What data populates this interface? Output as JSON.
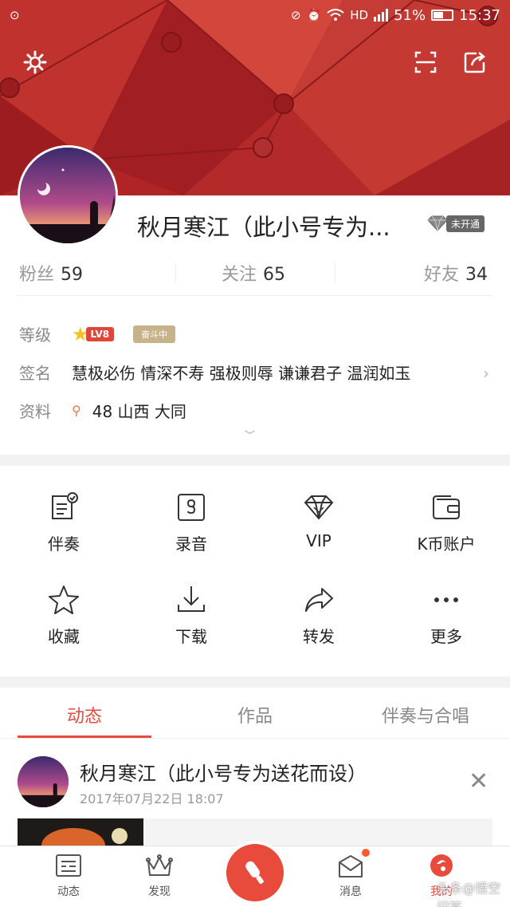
{
  "status": {
    "battery": "51%",
    "time": "15:37",
    "network": "HD"
  },
  "profile": {
    "name": "秋月寒江（此小号专为...",
    "vip_tag": "未开通",
    "stats": {
      "fans_label": "粉丝",
      "fans": "59",
      "follow_label": "关注",
      "follow": "65",
      "friends_label": "好友",
      "friends": "34"
    },
    "level_label": "等级",
    "level_badge": "LV8",
    "level_status": "奋斗中",
    "sign_label": "签名",
    "signature": "慧极必伤 情深不寿 强极则辱 谦谦君子 温润如玉",
    "info_label": "资料",
    "info": "48  山西 大同"
  },
  "actions": [
    {
      "label": "伴奏",
      "icon": "accompaniment-icon"
    },
    {
      "label": "录音",
      "icon": "recording-icon"
    },
    {
      "label": "VIP",
      "icon": "diamond-icon"
    },
    {
      "label": "K币账户",
      "icon": "wallet-icon"
    },
    {
      "label": "收藏",
      "icon": "star-icon"
    },
    {
      "label": "下载",
      "icon": "download-icon"
    },
    {
      "label": "转发",
      "icon": "share-icon"
    },
    {
      "label": "更多",
      "icon": "more-icon"
    }
  ],
  "tabs": [
    {
      "label": "动态",
      "active": true
    },
    {
      "label": "作品",
      "active": false
    },
    {
      "label": "伴奏与合唱",
      "active": false
    }
  ],
  "feed": {
    "name": "秋月寒江（此小号专为送花而设）",
    "time": "2017年07月22日 18:07"
  },
  "bottom_nav": [
    {
      "label": "动态",
      "active": false
    },
    {
      "label": "发现",
      "active": false
    },
    {
      "label": "消息",
      "active": false
    },
    {
      "label": "我的",
      "active": true
    }
  ],
  "watermark": "头条@悟空问答",
  "colors": {
    "accent": "#e84a3b",
    "banner": "#b8282a"
  }
}
